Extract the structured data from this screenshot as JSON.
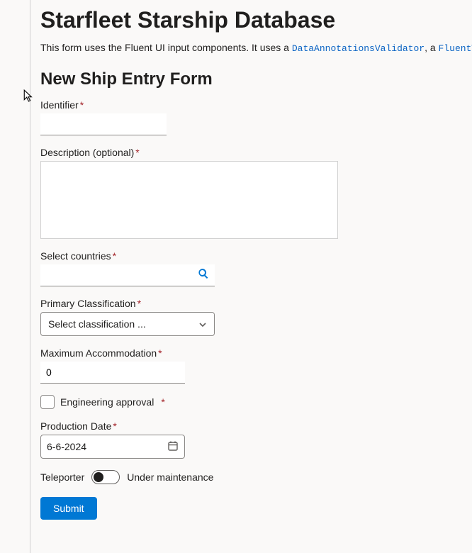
{
  "header": {
    "title": "Starfleet Starship Database",
    "intro_pre": "This form uses the Fluent UI input components. It uses a ",
    "code1": "DataAnnotationsValidator",
    "intro_mid": ", a ",
    "code2": "FluentValida"
  },
  "form": {
    "heading": "New Ship Entry Form",
    "identifier": {
      "label": "Identifier",
      "value": ""
    },
    "description": {
      "label": "Description (optional)",
      "value": ""
    },
    "countries": {
      "label": "Select countries",
      "value": ""
    },
    "classification": {
      "label": "Primary Classification",
      "selected": "Select classification ..."
    },
    "accommodation": {
      "label": "Maximum Accommodation",
      "value": "0"
    },
    "approval": {
      "label": "Engineering approval",
      "checked": false
    },
    "production": {
      "label": "Production Date",
      "value": "6-6-2024"
    },
    "teleporter": {
      "label": "Teleporter",
      "state_label": "Under maintenance",
      "on": false
    },
    "submit_label": "Submit",
    "required_marker": "*"
  }
}
